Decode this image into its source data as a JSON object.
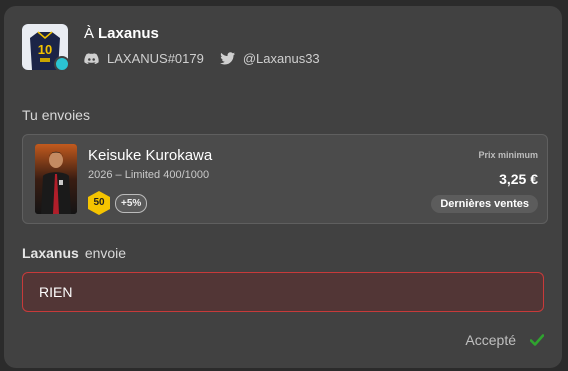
{
  "header": {
    "prefix": "À",
    "recipient_name": "Laxanus",
    "avatar_number": "10",
    "discord_icon": "discord-icon",
    "discord_handle": "LAXANUS#0179",
    "twitter_icon": "twitter-icon",
    "twitter_handle": "@Laxanus33",
    "status_color": "#2bc4d3"
  },
  "you_send": {
    "label": "Tu envoies",
    "card": {
      "player_name": "Keisuke Kurokawa",
      "meta": "2026 – Limited 400/1000",
      "level": "50",
      "level_color": "#f5c400",
      "boost": "+5%",
      "image_caption": "KEISUKE KUROKAWA",
      "min_price_label": "Prix minimum",
      "min_price": "3,25 €",
      "recent_sales_label": "Dernières ventes"
    }
  },
  "they_send": {
    "sender_name": "Laxanus",
    "verb": "envoie",
    "value": "RIEN",
    "border_color": "#c73a3a"
  },
  "status": {
    "label": "Accepté",
    "check_color": "#2fa32f"
  }
}
